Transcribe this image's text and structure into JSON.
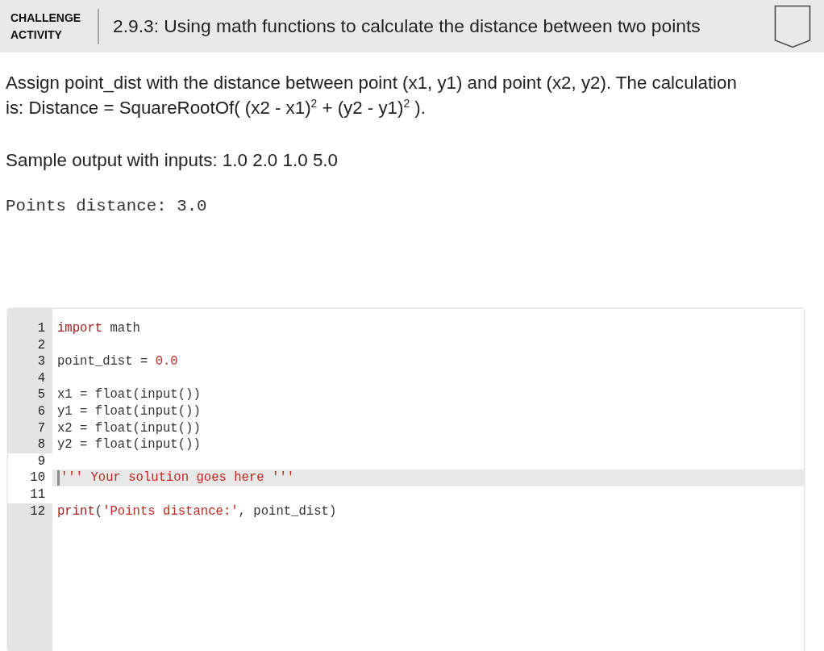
{
  "header": {
    "activity_type": "CHALLENGE ACTIVITY",
    "title": "2.9.3: Using math functions to calculate the distance between two points",
    "completed": false
  },
  "instructions": "Assign point_dist with the distance between point (x1, y1) and point (x2, y2). The calculation is: Distance = SquareRootOf( (x2 - x1)$^{2}$ + (y2 - y1)$^{2}$ ).",
  "sample_label": "Sample output with inputs: 1.0 2.0 1.0 5.0",
  "sample_output": "Points distance: 3.0",
  "editor": {
    "lines": [
      {
        "number": "1",
        "gutter_shaded": true,
        "active": false,
        "tokens": [
          {
            "kind": "keyword",
            "text": "import"
          },
          {
            "kind": "plain",
            "text": " math"
          }
        ]
      },
      {
        "number": "2",
        "gutter_shaded": true,
        "active": false
      },
      {
        "number": "3",
        "gutter_shaded": true,
        "active": false,
        "tokens": [
          {
            "kind": "plain",
            "text": "point_dist = "
          },
          {
            "kind": "number",
            "text": "0.0"
          }
        ]
      },
      {
        "number": "4",
        "gutter_shaded": true,
        "active": false
      },
      {
        "number": "5",
        "gutter_shaded": true,
        "active": false,
        "tokens": [
          {
            "kind": "plain",
            "text": "x1 = float(input())"
          }
        ]
      },
      {
        "number": "6",
        "gutter_shaded": true,
        "active": false,
        "tokens": [
          {
            "kind": "plain",
            "text": "y1 = float(input())"
          }
        ]
      },
      {
        "number": "7",
        "gutter_shaded": true,
        "active": false,
        "tokens": [
          {
            "kind": "plain",
            "text": "x2 = float(input())"
          }
        ]
      },
      {
        "number": "8",
        "gutter_shaded": true,
        "active": false,
        "tokens": [
          {
            "kind": "plain",
            "text": "y2 = float(input())"
          }
        ]
      },
      {
        "number": "9",
        "gutter_shaded": false,
        "active": false
      },
      {
        "number": "10",
        "gutter_shaded": false,
        "active": true,
        "tokens": [
          {
            "kind": "string",
            "text": "''' Your solution goes here '''"
          }
        ]
      },
      {
        "number": "11",
        "gutter_shaded": false,
        "active": false
      },
      {
        "number": "12",
        "gutter_shaded": true,
        "active": false,
        "tokens": [
          {
            "kind": "builtin",
            "text": "print"
          },
          {
            "kind": "plain",
            "text": "("
          },
          {
            "kind": "string",
            "text": "'Points distance:'"
          },
          {
            "kind": "plain",
            "text": ", point_dist)"
          }
        ]
      }
    ]
  }
}
